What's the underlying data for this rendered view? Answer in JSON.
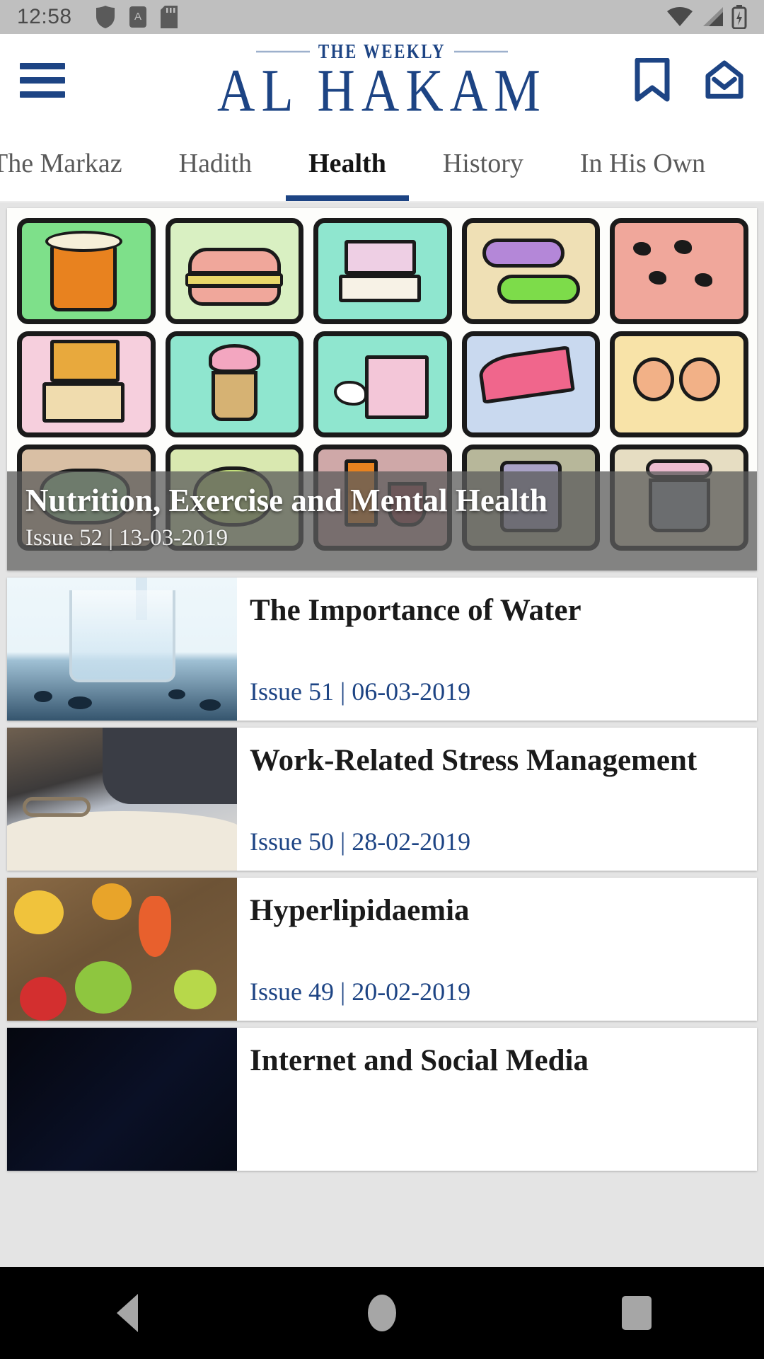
{
  "status_bar": {
    "time": "12:58",
    "left_icons": [
      "shield-icon",
      "app-badge-icon",
      "sd-card-icon"
    ],
    "right_icons": [
      "wifi-icon",
      "cell-signal-icon",
      "battery-charging-icon"
    ]
  },
  "header": {
    "menu_icon": "hamburger-menu-icon",
    "brand_kicker": "THE WEEKLY",
    "brand_title": "AL HAKAM",
    "bookmark_icon": "bookmark-icon",
    "mail_icon": "open-envelope-icon",
    "brand_color": "#1d4484"
  },
  "tabs": [
    {
      "label": "The Markaz",
      "active": false
    },
    {
      "label": "Hadith",
      "active": false
    },
    {
      "label": "Health",
      "active": true
    },
    {
      "label": "History",
      "active": false
    },
    {
      "label": "In His Own",
      "active": false
    }
  ],
  "featured": {
    "title": "Nutrition, Exercise and Mental Health",
    "meta": "Issue 52 | 13-03-2019",
    "image_alt": "food-and-drink-doodle-grid"
  },
  "articles": [
    {
      "title": "The Importance of Water",
      "meta": "Issue 51 | 06-03-2019",
      "thumb": "glass-of-water-photo",
      "thumb_class": "t-water"
    },
    {
      "title": "Work-Related Stress Management",
      "meta": "Issue 50 | 28-02-2019",
      "thumb": "desk-with-book-and-glasses-photo",
      "thumb_class": "t-desk"
    },
    {
      "title": "Hyperlipidaemia",
      "meta": "Issue 49 | 20-02-2019",
      "thumb": "vegetables-on-wood-photo",
      "thumb_class": "t-veg"
    },
    {
      "title": "Internet and Social Media",
      "meta": "",
      "thumb": "dark-night-photo",
      "thumb_class": "t-dark"
    }
  ],
  "nav_bar": {
    "back_label": "back-button",
    "home_label": "home-button",
    "recents_label": "recents-button"
  }
}
